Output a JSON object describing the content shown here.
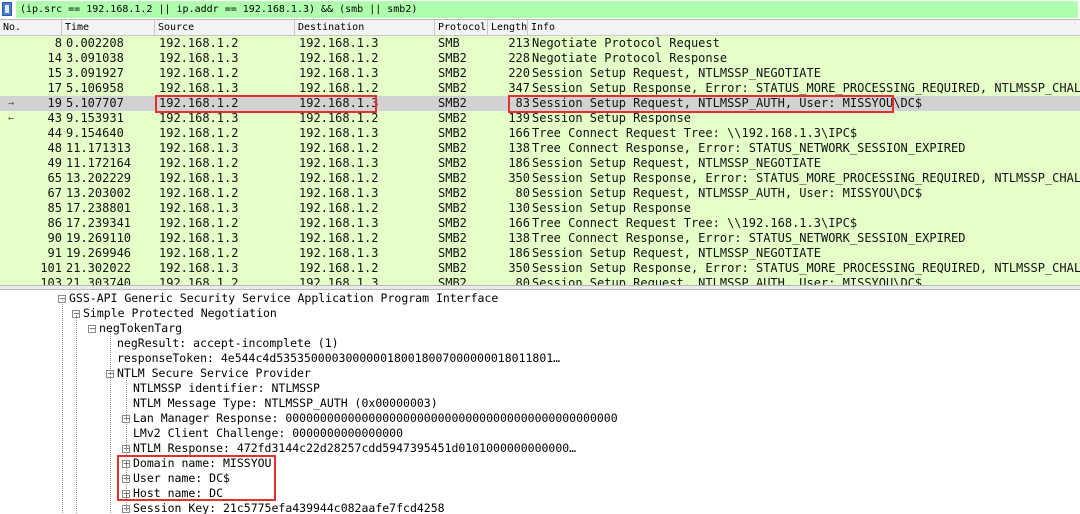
{
  "filter": {
    "text": "(ip.src == 192.168.1.2 || ip.addr == 192.168.1.3) && (smb || smb2)"
  },
  "columns": [
    "No.",
    "Time",
    "Source",
    "Destination",
    "Protocol",
    "Length",
    "Info"
  ],
  "rows": [
    {
      "mark": "",
      "no": "8",
      "time": "0.002208",
      "src": "192.168.1.2",
      "dst": "192.168.1.3",
      "proto": "SMB",
      "len": "213",
      "info": "Negotiate Protocol Request"
    },
    {
      "mark": "",
      "no": "14",
      "time": "3.091038",
      "src": "192.168.1.3",
      "dst": "192.168.1.2",
      "proto": "SMB2",
      "len": "228",
      "info": "Negotiate Protocol Response"
    },
    {
      "mark": "",
      "no": "15",
      "time": "3.091927",
      "src": "192.168.1.2",
      "dst": "192.168.1.3",
      "proto": "SMB2",
      "len": "220",
      "info": "Session Setup Request, NTLMSSP_NEGOTIATE"
    },
    {
      "mark": "",
      "no": "17",
      "time": "5.106958",
      "src": "192.168.1.3",
      "dst": "192.168.1.2",
      "proto": "SMB2",
      "len": "347",
      "info": "Session Setup Response, Error: STATUS_MORE_PROCESSING_REQUIRED, NTLMSSP_CHALLENGE"
    },
    {
      "mark": "→",
      "no": "19",
      "time": "5.107707",
      "src": "192.168.1.2",
      "dst": "192.168.1.3",
      "proto": "SMB2",
      "len": "83",
      "info": "Session Setup Request, NTLMSSP_AUTH, User: MISSYOU\\DC$"
    },
    {
      "mark": "←",
      "no": "43",
      "time": "9.153931",
      "src": "192.168.1.3",
      "dst": "192.168.1.2",
      "proto": "SMB2",
      "len": "139",
      "info": "Session Setup Response"
    },
    {
      "mark": "",
      "no": "44",
      "time": "9.154640",
      "src": "192.168.1.2",
      "dst": "192.168.1.3",
      "proto": "SMB2",
      "len": "166",
      "info": "Tree Connect Request Tree: \\\\192.168.1.3\\IPC$"
    },
    {
      "mark": "",
      "no": "48",
      "time": "11.171313",
      "src": "192.168.1.3",
      "dst": "192.168.1.2",
      "proto": "SMB2",
      "len": "138",
      "info": "Tree Connect Response, Error: STATUS_NETWORK_SESSION_EXPIRED"
    },
    {
      "mark": "",
      "no": "49",
      "time": "11.172164",
      "src": "192.168.1.2",
      "dst": "192.168.1.3",
      "proto": "SMB2",
      "len": "186",
      "info": "Session Setup Request, NTLMSSP_NEGOTIATE"
    },
    {
      "mark": "",
      "no": "65",
      "time": "13.202229",
      "src": "192.168.1.3",
      "dst": "192.168.1.2",
      "proto": "SMB2",
      "len": "350",
      "info": "Session Setup Response, Error: STATUS_MORE_PROCESSING_REQUIRED, NTLMSSP_CHALLENGE"
    },
    {
      "mark": "",
      "no": "67",
      "time": "13.203002",
      "src": "192.168.1.2",
      "dst": "192.168.1.3",
      "proto": "SMB2",
      "len": "80",
      "info": "Session Setup Request, NTLMSSP_AUTH, User: MISSYOU\\DC$"
    },
    {
      "mark": "",
      "no": "85",
      "time": "17.238801",
      "src": "192.168.1.3",
      "dst": "192.168.1.2",
      "proto": "SMB2",
      "len": "130",
      "info": "Session Setup Response"
    },
    {
      "mark": "",
      "no": "86",
      "time": "17.239341",
      "src": "192.168.1.2",
      "dst": "192.168.1.3",
      "proto": "SMB2",
      "len": "166",
      "info": "Tree Connect Request Tree: \\\\192.168.1.3\\IPC$"
    },
    {
      "mark": "",
      "no": "90",
      "time": "19.269110",
      "src": "192.168.1.3",
      "dst": "192.168.1.2",
      "proto": "SMB2",
      "len": "138",
      "info": "Tree Connect Response, Error: STATUS_NETWORK_SESSION_EXPIRED"
    },
    {
      "mark": "",
      "no": "91",
      "time": "19.269946",
      "src": "192.168.1.2",
      "dst": "192.168.1.3",
      "proto": "SMB2",
      "len": "186",
      "info": "Session Setup Request, NTLMSSP_NEGOTIATE"
    },
    {
      "mark": "",
      "no": "101",
      "time": "21.302022",
      "src": "192.168.1.3",
      "dst": "192.168.1.2",
      "proto": "SMB2",
      "len": "350",
      "info": "Session Setup Response, Error: STATUS_MORE_PROCESSING_REQUIRED, NTLMSSP_CHALLENGE"
    },
    {
      "mark": "",
      "no": "103",
      "time": "21.303740",
      "src": "192.168.1.2",
      "dst": "192.168.1.3",
      "proto": "SMB2",
      "len": "80",
      "info": "Session Setup Request, NTLMSSP_AUTH, User: MISSYOU\\DC$"
    }
  ],
  "details": [
    {
      "text": "GSS-API Generic Security Service Application Program Interface",
      "toggle": "−"
    },
    {
      "text": "Simple Protected Negotiation",
      "toggle": "−"
    },
    {
      "text": "negTokenTarg",
      "toggle": "−"
    },
    {
      "text": "negResult: accept-incomplete (1)",
      "toggle": ""
    },
    {
      "text": "responseToken: 4e544c4d5353500003000000180018007000000018011801…",
      "toggle": ""
    },
    {
      "text": "NTLM Secure Service Provider",
      "toggle": "−"
    },
    {
      "text": "NTLMSSP identifier: NTLMSSP",
      "toggle": ""
    },
    {
      "text": "NTLM Message Type: NTLMSSP_AUTH (0x00000003)",
      "toggle": ""
    },
    {
      "text": "Lan Manager Response: 000000000000000000000000000000000000000000000000",
      "toggle": "+"
    },
    {
      "text": "LMv2 Client Challenge: 0000000000000000",
      "toggle": ""
    },
    {
      "text": "NTLM Response: 472fd3144c22d28257cdd5947395451d0101000000000000…",
      "toggle": "+"
    },
    {
      "text": "Domain name: MISSYOU",
      "toggle": "+"
    },
    {
      "text": "User name: DC$",
      "toggle": "+"
    },
    {
      "text": "Host name: DC",
      "toggle": "+"
    },
    {
      "text": "Session Key: 21c5775efa439944c082aafe7fcd4258",
      "toggle": "+"
    }
  ]
}
